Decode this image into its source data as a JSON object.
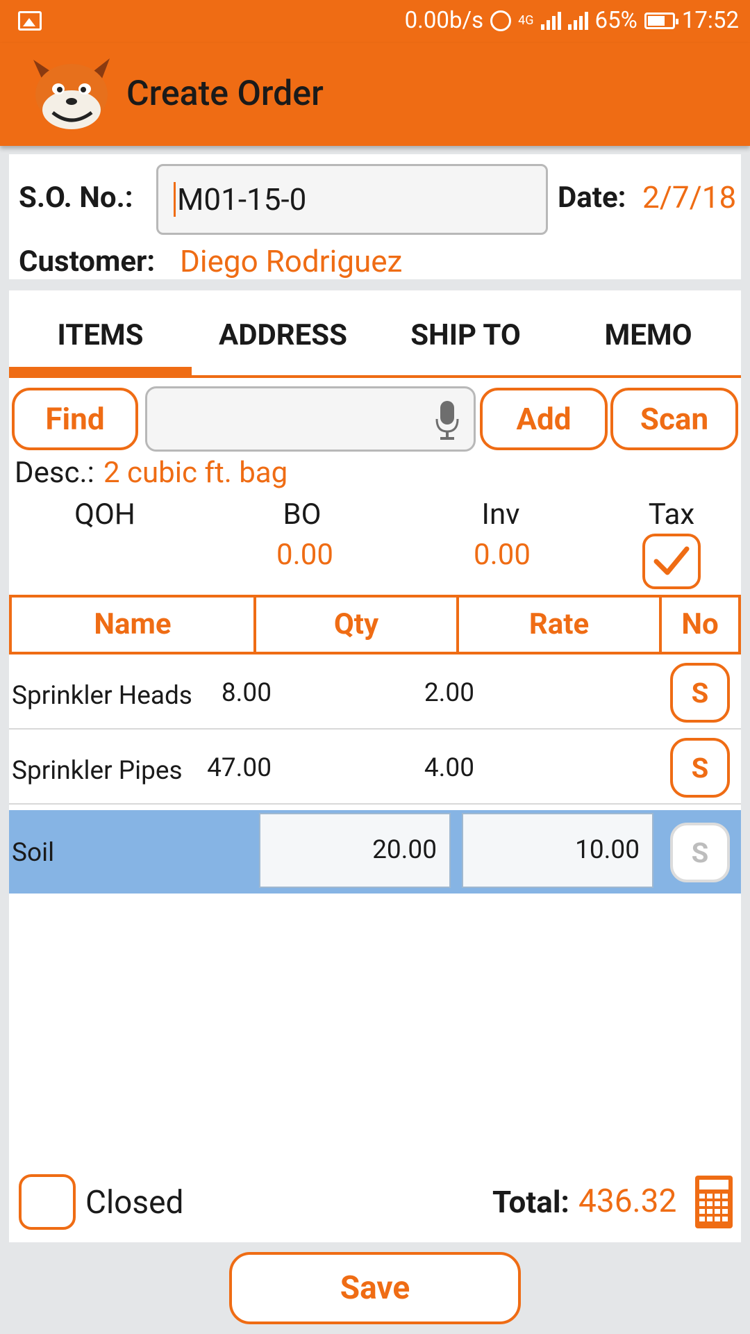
{
  "status_bar": {
    "speed": "0.00b/s",
    "network": "4G",
    "battery": "65%",
    "time": "17:52"
  },
  "app_bar": {
    "title": "Create Order"
  },
  "order": {
    "so_label": "S.O. No.:",
    "so_value": "M01-15-0",
    "date_label": "Date:",
    "date_value": "2/7/18",
    "customer_label": "Customer:",
    "customer_value": "Diego Rodriguez"
  },
  "tabs": [
    {
      "label": "ITEMS",
      "active": true
    },
    {
      "label": "ADDRESS",
      "active": false
    },
    {
      "label": "SHIP TO",
      "active": false
    },
    {
      "label": "MEMO",
      "active": false
    }
  ],
  "toolbar": {
    "find_label": "Find",
    "search_value": "",
    "add_label": "Add",
    "scan_label": "Scan"
  },
  "desc": {
    "label": "Desc.:",
    "value": "2 cubic ft. bag"
  },
  "stats": {
    "qoh_label": "QOH",
    "qoh_value": "",
    "bo_label": "BO",
    "bo_value": "0.00",
    "inv_label": "Inv",
    "inv_value": "0.00",
    "tax_label": "Tax",
    "tax_checked": true
  },
  "grid": {
    "headers": [
      "Name",
      "Qty",
      "Rate",
      "No"
    ],
    "rows": [
      {
        "name": "Sprinkler Heads",
        "qty": "8.00",
        "rate": "2.00",
        "s": "S"
      },
      {
        "name": "Sprinkler Pipes",
        "qty": "47.00",
        "rate": "4.00",
        "s": "S"
      },
      {
        "name": "Soil",
        "qty": "20.00",
        "rate": "10.00",
        "s": "S",
        "selected": true
      }
    ]
  },
  "footer": {
    "closed_label": "Closed",
    "closed_checked": false,
    "total_label": "Total:",
    "total_value": "436.32"
  },
  "save_label": "Save",
  "colors": {
    "accent": "#ef6c14",
    "selected_row": "#86b4e4"
  }
}
